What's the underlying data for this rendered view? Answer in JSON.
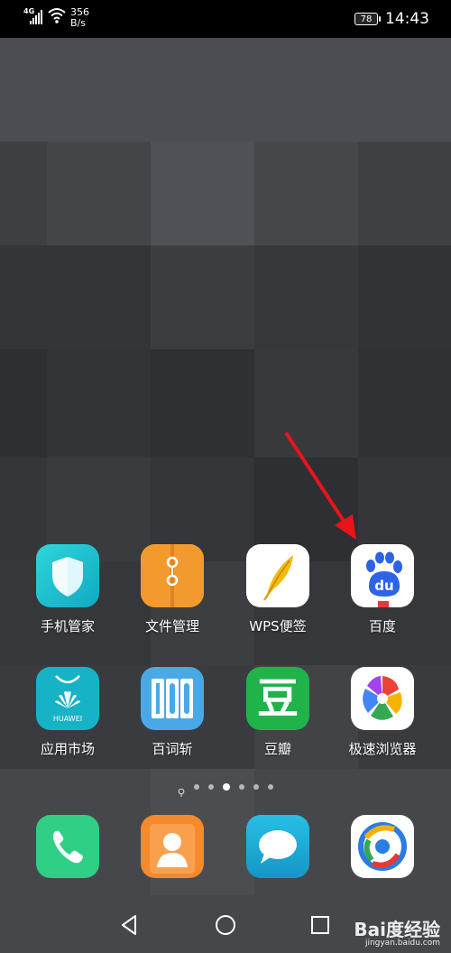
{
  "status_bar": {
    "network_type": "4G",
    "speed_value": "356",
    "speed_unit": "B/s",
    "battery_level": "78",
    "time": "14:43"
  },
  "apps_row1": [
    {
      "label": "手机管家",
      "icon": "phone-manager-shield-icon",
      "color": "#1ec3d1"
    },
    {
      "label": "文件管理",
      "icon": "file-manager-folder-icon",
      "color": "#f29a2e"
    },
    {
      "label": "WPS便签",
      "icon": "wps-notes-feather-icon",
      "color": "#ffffff"
    },
    {
      "label": "百度",
      "icon": "baidu-paw-icon",
      "color": "#ffffff"
    }
  ],
  "apps_row2": [
    {
      "label": "应用市场",
      "icon": "huawei-appgallery-icon",
      "color": "#19b6c8",
      "icon_text": "HUAWEI"
    },
    {
      "label": "百词斩",
      "icon": "baicizhan-icon",
      "color": "#45a8e8"
    },
    {
      "label": "豆瓣",
      "icon": "douban-icon",
      "color": "#22b14c",
      "icon_text": "豆"
    },
    {
      "label": "极速浏览器",
      "icon": "speed-browser-pinwheel-icon",
      "color": "#ffffff"
    }
  ],
  "page_indicator": {
    "count": 7,
    "active_index": 3
  },
  "dock": [
    {
      "icon": "phone-call-icon",
      "color": "#2fcf86"
    },
    {
      "icon": "contacts-icon",
      "color": "#f58a2a"
    },
    {
      "icon": "messages-icon",
      "color": "#1aa7d6"
    },
    {
      "icon": "browser-icon",
      "color": "#ffffff"
    }
  ],
  "watermark": {
    "logo": "Bai度经验",
    "url": "jingyan.baidu.com"
  },
  "colors": {
    "arrow": "#e8141a",
    "status_bar_bg": "#000000"
  }
}
